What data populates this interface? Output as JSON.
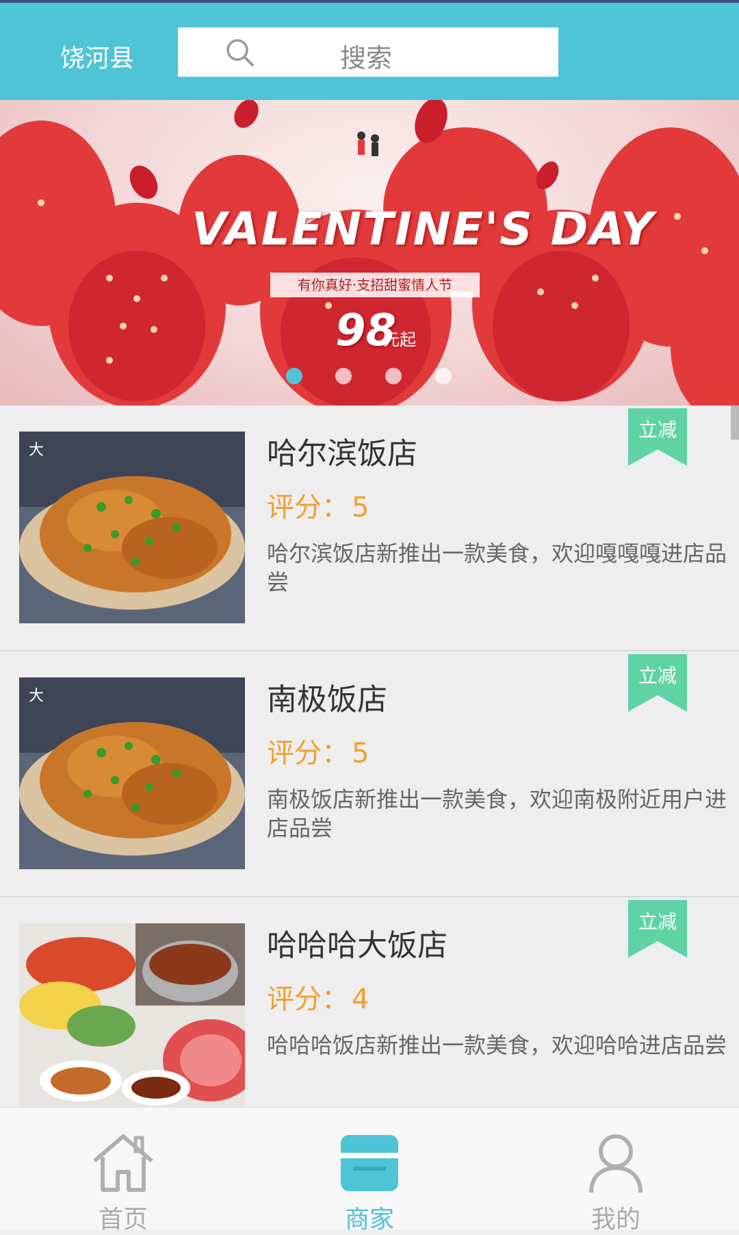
{
  "header": {
    "city": "饶河县",
    "search_placeholder": "搜索",
    "icon": "search-icon"
  },
  "banner": {
    "title": "VALENTINE'S DAY",
    "subtitle": "有你真好·支招甜蜜情人节",
    "price": "98",
    "price_unit": "元起",
    "slide_count": 4,
    "active_slide": 1
  },
  "shops": [
    {
      "name": "哈尔滨饭店",
      "rating_label": "评分：",
      "rating": "5",
      "description": "哈尔滨饭店新推出一款美食，欢迎嘎嘎嘎进店品尝",
      "badge": "立减",
      "image": "fried-food-photo"
    },
    {
      "name": "南极饭店",
      "rating_label": "评分：",
      "rating": "5",
      "description": "南极饭店新推出一款美食，欢迎南极附近用户进店品尝",
      "badge": "立减",
      "image": "fried-food-photo"
    },
    {
      "name": "哈哈哈大饭店",
      "rating_label": "评分：",
      "rating": "4",
      "description": "哈哈哈饭店新推出一款美食，欢迎哈哈进店品尝",
      "badge": "立减",
      "image": "hotpot-photo"
    }
  ],
  "bottom_nav": {
    "items": [
      {
        "label": "首页",
        "icon": "home-icon",
        "active": false
      },
      {
        "label": "商家",
        "icon": "store-icon",
        "active": true
      },
      {
        "label": "我的",
        "icon": "user-icon",
        "active": false
      }
    ]
  },
  "colors": {
    "accent": "#4fc4d6",
    "rating": "#f0a030",
    "badge": "#5fd3a4"
  }
}
